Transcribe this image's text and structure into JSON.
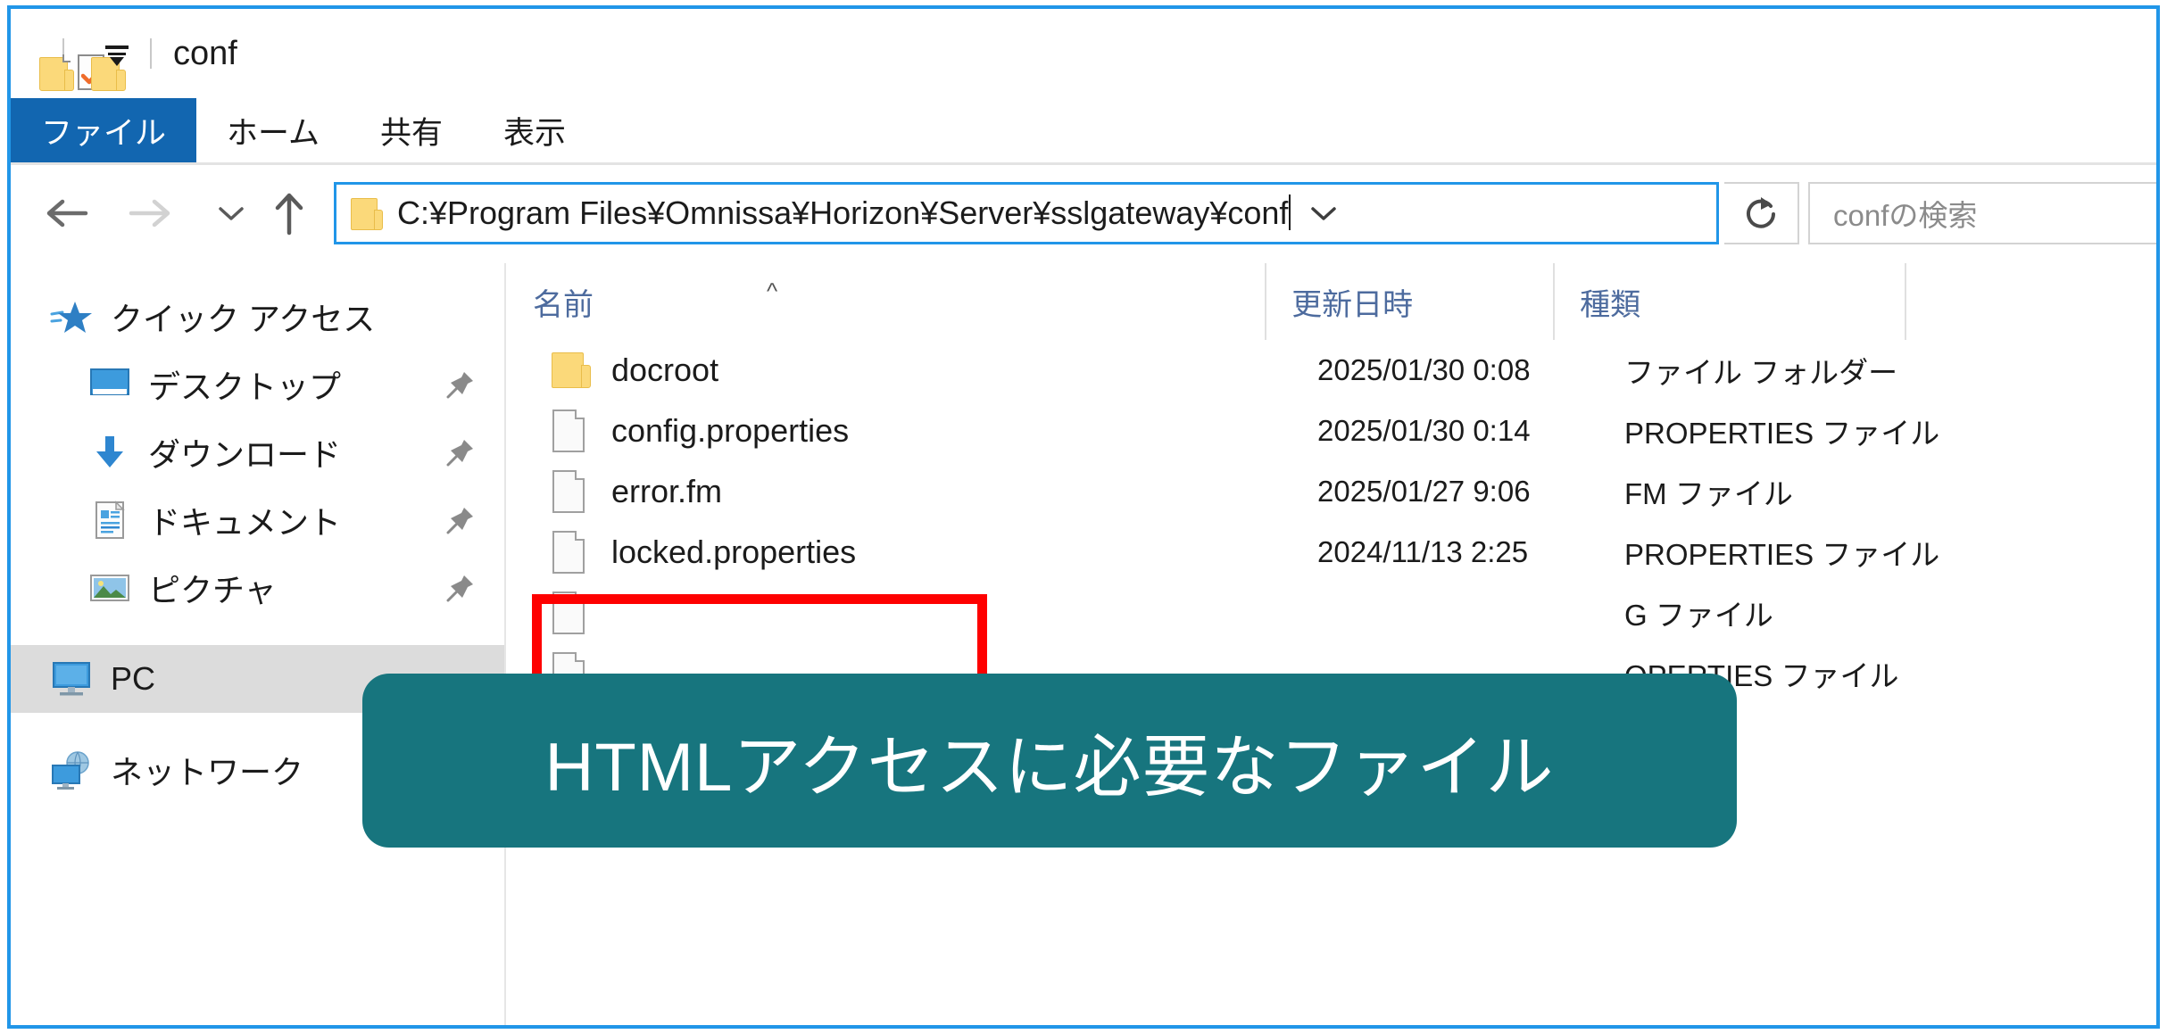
{
  "window": {
    "title": "conf",
    "quick_access_icons": [
      "folder-icon",
      "save-document-icon",
      "new-folder-icon",
      "customize-dropdown-icon"
    ]
  },
  "ribbon": {
    "tabs": [
      {
        "label": "ファイル",
        "active": true
      },
      {
        "label": "ホーム",
        "active": false
      },
      {
        "label": "共有",
        "active": false
      },
      {
        "label": "表示",
        "active": false
      }
    ]
  },
  "navbar": {
    "back_icon": "back-arrow-icon",
    "forward_icon": "forward-arrow-icon",
    "recent_icon": "chevron-down-icon",
    "up_icon": "up-arrow-icon",
    "address_path": "C:¥Program Files¥Omnissa¥Horizon¥Server¥sslgateway¥conf",
    "address_dropdown_icon": "chevron-down-icon",
    "refresh_icon": "refresh-icon",
    "search_placeholder": "confの検索"
  },
  "nav_pane": {
    "items": [
      {
        "label": "クイック アクセス",
        "icon": "quick-access-star-icon",
        "pinned": false,
        "selected": false,
        "root": true
      },
      {
        "label": "デスクトップ",
        "icon": "desktop-icon",
        "pinned": true,
        "selected": false,
        "root": false
      },
      {
        "label": "ダウンロード",
        "icon": "downloads-icon",
        "pinned": true,
        "selected": false,
        "root": false
      },
      {
        "label": "ドキュメント",
        "icon": "documents-icon",
        "pinned": true,
        "selected": false,
        "root": false
      },
      {
        "label": "ピクチャ",
        "icon": "pictures-icon",
        "pinned": true,
        "selected": false,
        "root": false
      },
      {
        "label": "PC",
        "icon": "this-pc-icon",
        "pinned": false,
        "selected": true,
        "root": true
      },
      {
        "label": "ネットワーク",
        "icon": "network-icon",
        "pinned": false,
        "selected": false,
        "root": true
      }
    ]
  },
  "file_list": {
    "columns": [
      {
        "key": "name",
        "label": "名前",
        "sorted": "asc"
      },
      {
        "key": "date",
        "label": "更新日時",
        "sorted": ""
      },
      {
        "key": "type",
        "label": "種類",
        "sorted": ""
      }
    ],
    "sort_caret": "^",
    "rows": [
      {
        "name": "docroot",
        "date": "2025/01/30 0:08",
        "type": "ファイル フォルダー",
        "icon": "folder-icon"
      },
      {
        "name": "config.properties",
        "date": "2025/01/30 0:14",
        "type": "PROPERTIES ファイル",
        "icon": "file-icon"
      },
      {
        "name": "error.fm",
        "date": "2025/01/27 9:06",
        "type": "FM ファイル",
        "icon": "file-icon"
      },
      {
        "name": "locked.properties",
        "date": "2024/11/13 2:25",
        "type": "PROPERTIES ファイル",
        "icon": "file-icon"
      },
      {
        "name": "",
        "date": "",
        "type": "G ファイル",
        "icon": "file-icon"
      },
      {
        "name": "",
        "date": "",
        "type": "OPERTIES ファイル",
        "icon": "file-icon"
      }
    ]
  },
  "annotations": {
    "highlight_box_color": "#fe0000",
    "callout_text": "HTMLアクセスに必要なファイル",
    "callout_bg_color": "#17757e",
    "callout_text_color": "#ffffff"
  },
  "colors": {
    "window_border": "#2196e8",
    "file_tab_bg": "#1266b0",
    "selection_bg": "#dcdcdc",
    "header_text": "#4d6b9e"
  }
}
